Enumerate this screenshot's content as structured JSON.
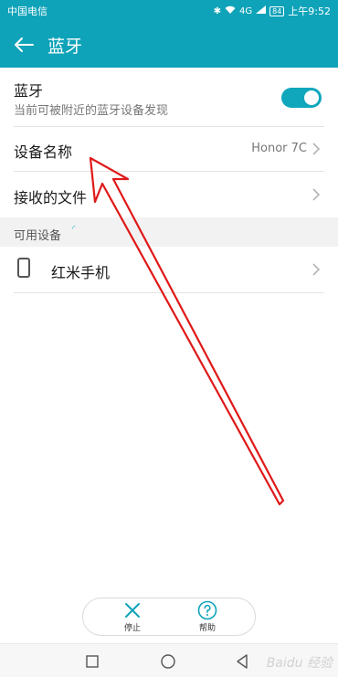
{
  "status_bar": {
    "carrier": "中国电信",
    "network": "4G",
    "battery": "84",
    "time": "上午9:52"
  },
  "app_bar": {
    "title": "蓝牙"
  },
  "bluetooth": {
    "label": "蓝牙",
    "description": "当前可被附近的蓝牙设备发现",
    "enabled": true
  },
  "device_name": {
    "label": "设备名称",
    "value": "Honor 7C"
  },
  "received_files": {
    "label": "接收的文件"
  },
  "available_section": {
    "title": "可用设备"
  },
  "devices": [
    {
      "name": "红米手机"
    }
  ],
  "bottom_actions": {
    "stop": "停止",
    "help": "帮助"
  },
  "watermark": "Baidu 经验",
  "colors": {
    "accent": "#0fa3b9",
    "annotation": "#e01818"
  }
}
